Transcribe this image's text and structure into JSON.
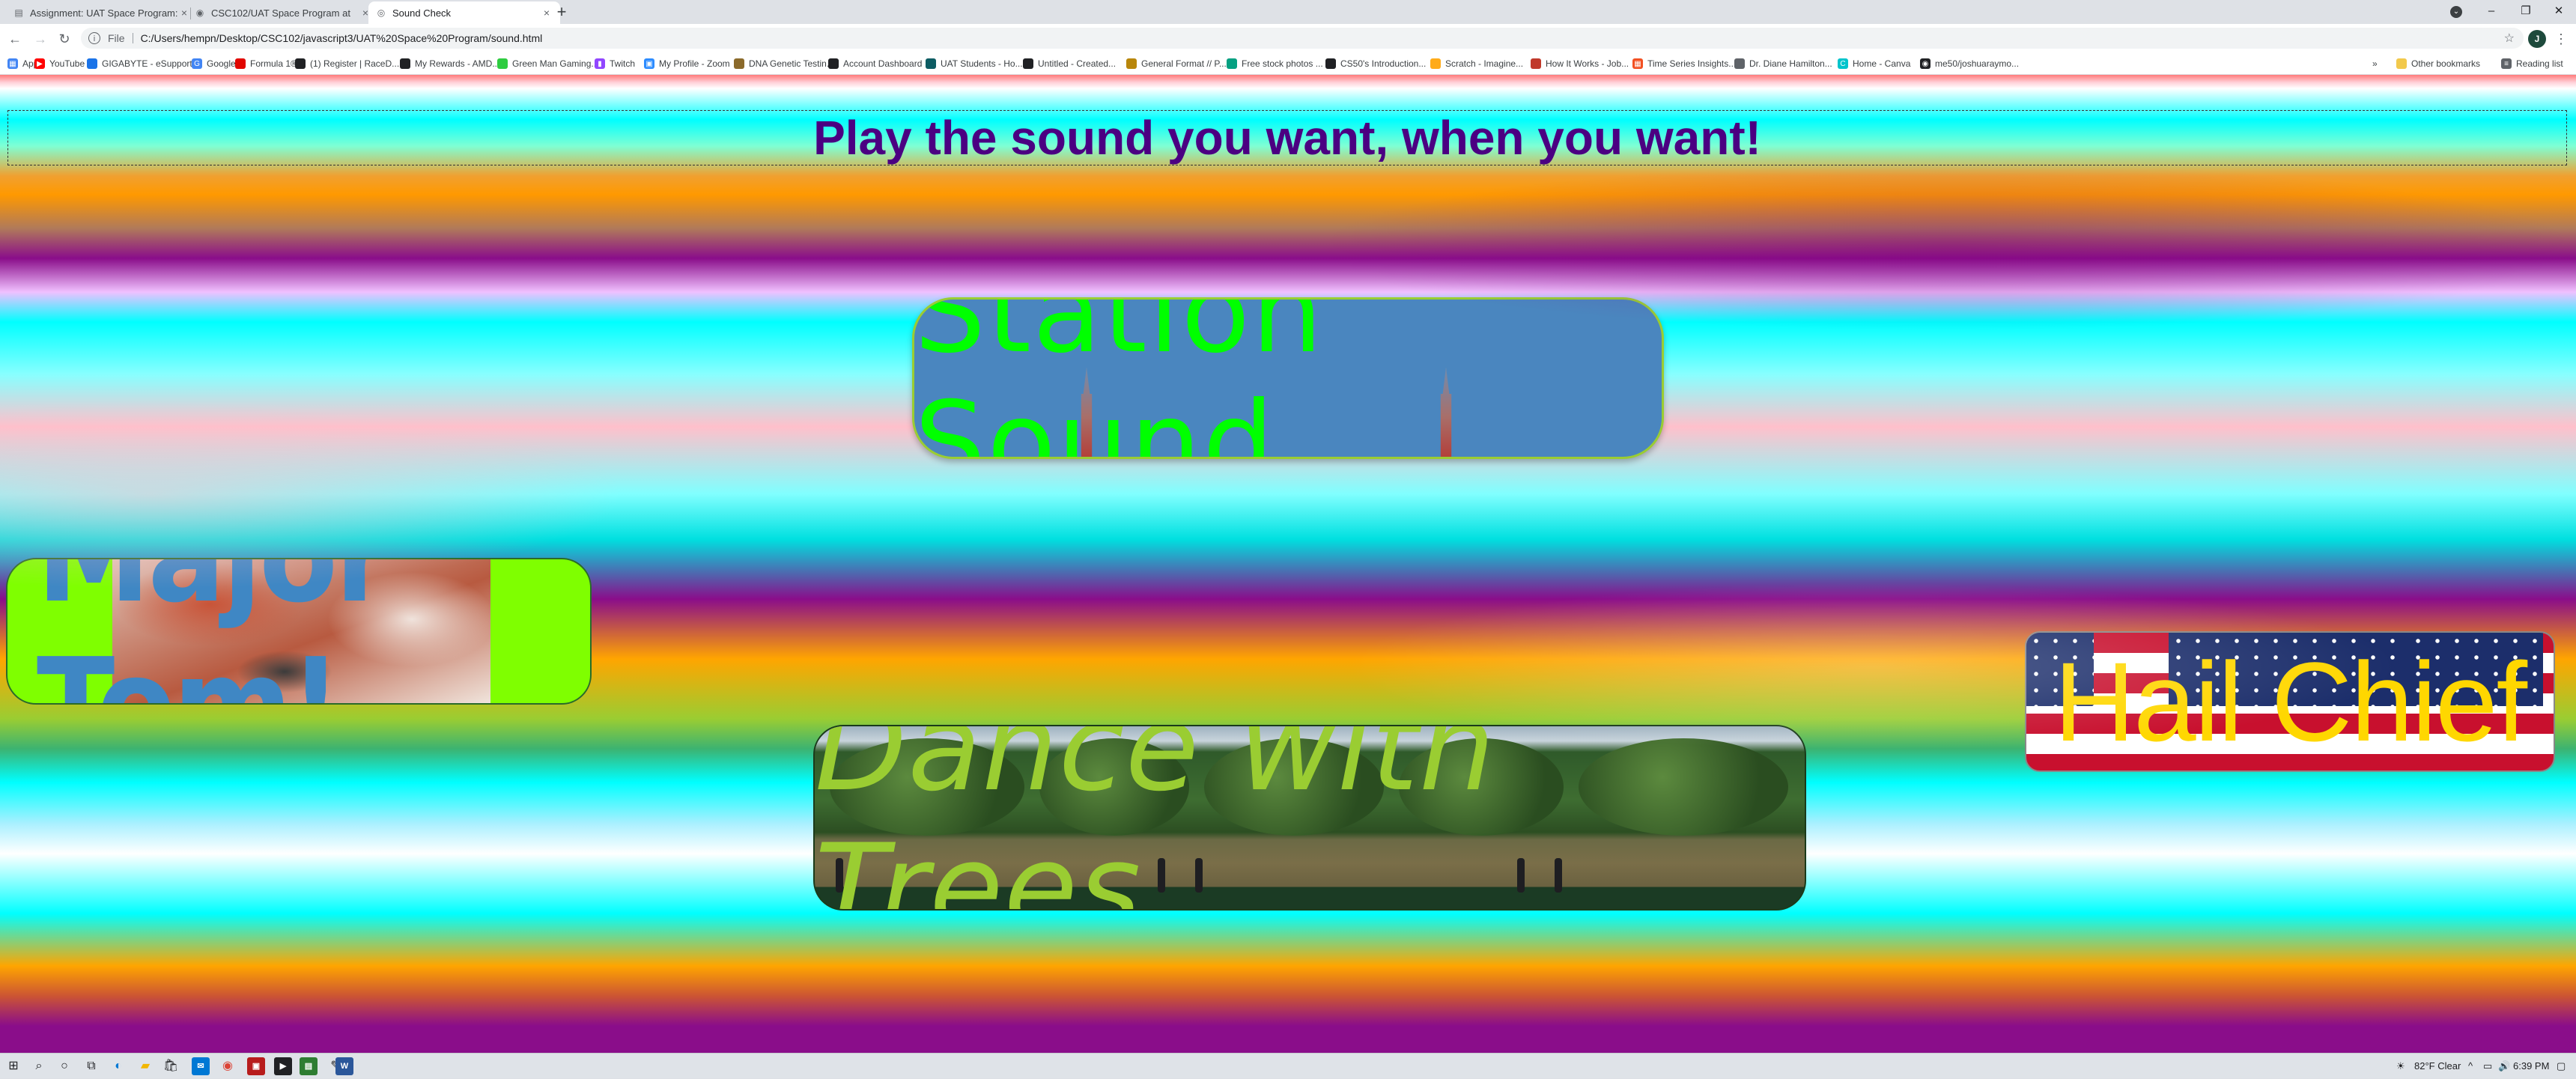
{
  "browser": {
    "tabs": [
      {
        "title": "Assignment: UAT Space Program: ",
        "icon": "document-icon",
        "active": false
      },
      {
        "title": "CSC102/UAT Space Program at ",
        "icon": "github-icon",
        "active": false
      },
      {
        "title": "Sound Check",
        "icon": "globe-icon",
        "active": true
      }
    ],
    "address": {
      "scheme": "File",
      "url": "C:/Users/hempn/Desktop/CSC102/javascript3/UAT%20Space%20Program/sound.html"
    },
    "bookmarks": [
      {
        "label": "Apps",
        "icon": "apps-grid-icon",
        "color": "#4285f4"
      },
      {
        "label": "YouTube",
        "icon": "youtube-icon",
        "color": "#ff0000"
      },
      {
        "label": "GIGABYTE - eSupport",
        "icon": "gigabyte-icon",
        "color": "#1a73e8"
      },
      {
        "label": "Google",
        "icon": "google-icon",
        "color": "#4285f4"
      },
      {
        "label": "Formula 1®",
        "icon": "f1-icon",
        "color": "#e10600"
      },
      {
        "label": "(1) Register | RaceD...",
        "icon": "raced-icon",
        "color": "#202124"
      },
      {
        "label": "My Rewards - AMD...",
        "icon": "amd-icon",
        "color": "#202124"
      },
      {
        "label": "Green Man Gaming...",
        "icon": "gmg-icon",
        "color": "#2ecc40"
      },
      {
        "label": "Twitch",
        "icon": "twitch-icon",
        "color": "#9146ff"
      },
      {
        "label": "My Profile - Zoom",
        "icon": "zoom-icon",
        "color": "#2d8cff"
      },
      {
        "label": "DNA Genetic Testin...",
        "icon": "dna-icon",
        "color": "#8b6a2b"
      },
      {
        "label": "Account Dashboard",
        "icon": "dashboard-icon",
        "color": "#202124"
      },
      {
        "label": "UAT Students - Ho...",
        "icon": "uat-icon",
        "color": "#0d5c63"
      },
      {
        "label": "Untitled - Created...",
        "icon": "untitled-icon",
        "color": "#202124"
      },
      {
        "label": "General Format // P...",
        "icon": "purdue-icon",
        "color": "#b8860b"
      },
      {
        "label": "Free stock photos ...",
        "icon": "pexels-icon",
        "color": "#05a081"
      },
      {
        "label": "CS50's Introduction...",
        "icon": "cs50-icon",
        "color": "#202124"
      },
      {
        "label": "Scratch - Imagine...",
        "icon": "scratch-icon",
        "color": "#ffab19"
      },
      {
        "label": "How It Works - Job...",
        "icon": "job-icon",
        "color": "#c0392b"
      },
      {
        "label": "Time Series Insights...",
        "icon": "microsoft-icon",
        "color": "#f25022"
      },
      {
        "label": "Dr. Diane Hamilton...",
        "icon": "profile-icon",
        "color": "#5f6368"
      },
      {
        "label": "Home - Canva",
        "icon": "canva-icon",
        "color": "#00c4cc"
      },
      {
        "label": "me50/joshuaraymo...",
        "icon": "github-icon",
        "color": "#202124"
      }
    ],
    "bookmarks_more": "»",
    "other_bookmarks": "Other bookmarks",
    "reading_list": "Reading list",
    "profile_initial": "J"
  },
  "page": {
    "headline": "Play the sound you want, when you want!",
    "buttons": {
      "station": "Station Sound",
      "tom": "Major Tom!",
      "trees": "Dance with Trees",
      "chief": "Hail Chief"
    }
  },
  "taskbar": {
    "weather": "82°F  Clear",
    "time": "6:39 PM"
  }
}
